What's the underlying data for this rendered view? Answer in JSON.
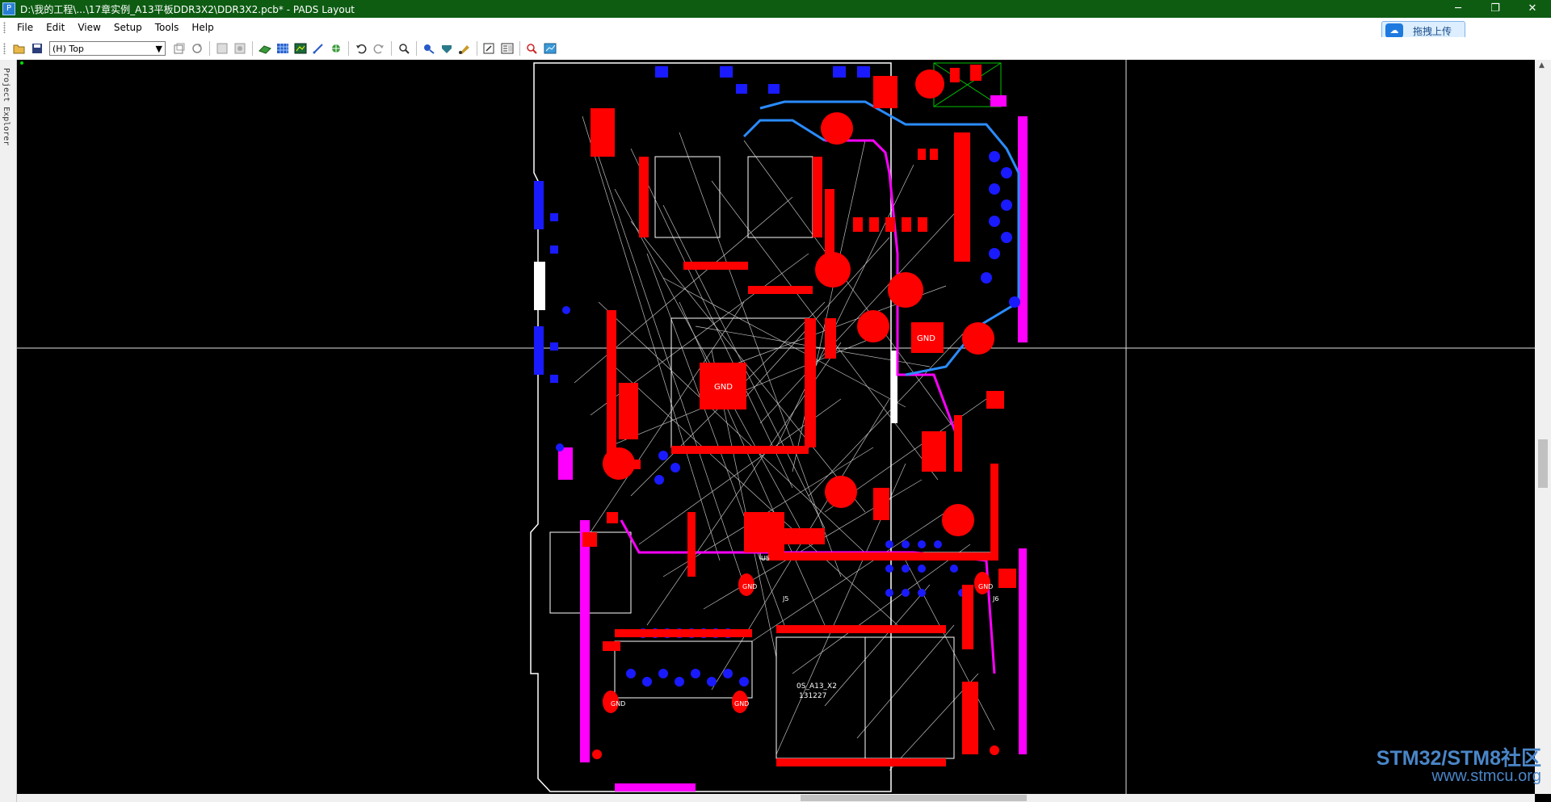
{
  "window": {
    "title": "D:\\我的工程\\...\\17章实例_A13平板DDR3X2\\DDR3X2.pcb* - PADS Layout",
    "app_icon": "pads-icon",
    "controls": {
      "minimize": "─",
      "restore": "❐",
      "close": "✕"
    }
  },
  "menubar": {
    "file": "File",
    "edit": "Edit",
    "view": "View",
    "setup": "Setup",
    "tools": "Tools",
    "help": "Help"
  },
  "upload_button": {
    "label": "拖拽上传"
  },
  "toolbar": {
    "layer_select": "(H) Top"
  },
  "side_panel": {
    "label": "Project Explorer"
  },
  "pcb": {
    "gnd_labels": [
      "GND",
      "GND",
      "GND",
      "GND",
      "GND",
      "GND"
    ],
    "chip_label_line1": "0S_A13_X2",
    "chip_label_line2": "131227",
    "ref_labels": [
      "U5",
      "J5",
      "J6"
    ],
    "colors": {
      "pad": "#ff0000",
      "via": "#1a1aff",
      "trace_magenta": "#ff00ff",
      "trace_blue": "#2a8cff",
      "ratsnest": "#ffffff",
      "outline": "#ffffff",
      "keepout": "#00c000"
    }
  },
  "watermark": {
    "title": "STM32/STM8社区",
    "url": "www.stmcu.org"
  }
}
